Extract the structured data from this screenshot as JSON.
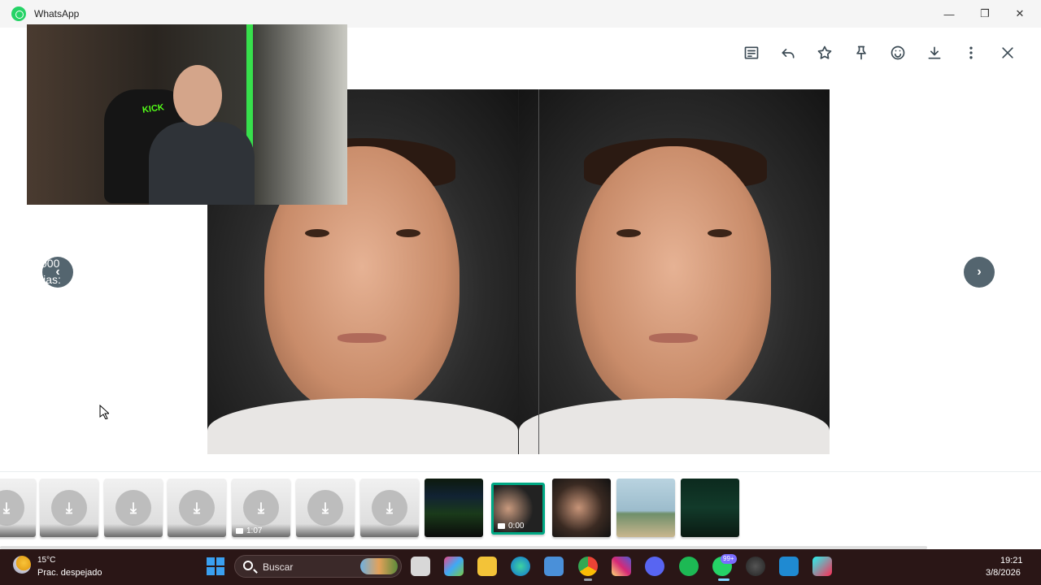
{
  "window": {
    "title": "WhatsApp",
    "controls": {
      "minimize": "—",
      "restore": "❐",
      "close": "✕"
    }
  },
  "toolbar": {
    "icons": [
      "message-icon",
      "reply-icon",
      "star-icon",
      "pin-icon",
      "emoji-icon",
      "download-icon",
      "more-icon",
      "close-icon"
    ]
  },
  "viewer": {
    "prev_overlay_text": "000\nlias:",
    "prev_arrow": "‹",
    "next_arrow": "›"
  },
  "media_strip": {
    "items": [
      {
        "type": "download",
        "duration": ""
      },
      {
        "type": "download",
        "duration": ""
      },
      {
        "type": "download",
        "duration": ""
      },
      {
        "type": "download",
        "duration": ""
      },
      {
        "type": "video-download",
        "duration": "1:07"
      },
      {
        "type": "download",
        "duration": ""
      },
      {
        "type": "download",
        "duration": ""
      },
      {
        "type": "image",
        "duration": ""
      },
      {
        "type": "video-selected",
        "duration": "0:00"
      },
      {
        "type": "image",
        "duration": ""
      },
      {
        "type": "image",
        "duration": ""
      },
      {
        "type": "image",
        "duration": ""
      }
    ]
  },
  "taskbar": {
    "weather": {
      "temp": "15°C",
      "desc": "Prac. despejado"
    },
    "search_placeholder": "Buscar",
    "whatsapp_badge": "99+",
    "clock": {
      "time": "19:21",
      "date": "3/8/2026"
    }
  },
  "colors": {
    "accent": "#00a884",
    "taskbar": "#2a1616",
    "nav_button": "#54656f",
    "kick_green": "#53fc18"
  },
  "webcam_overlay": {
    "label": "KICK"
  }
}
